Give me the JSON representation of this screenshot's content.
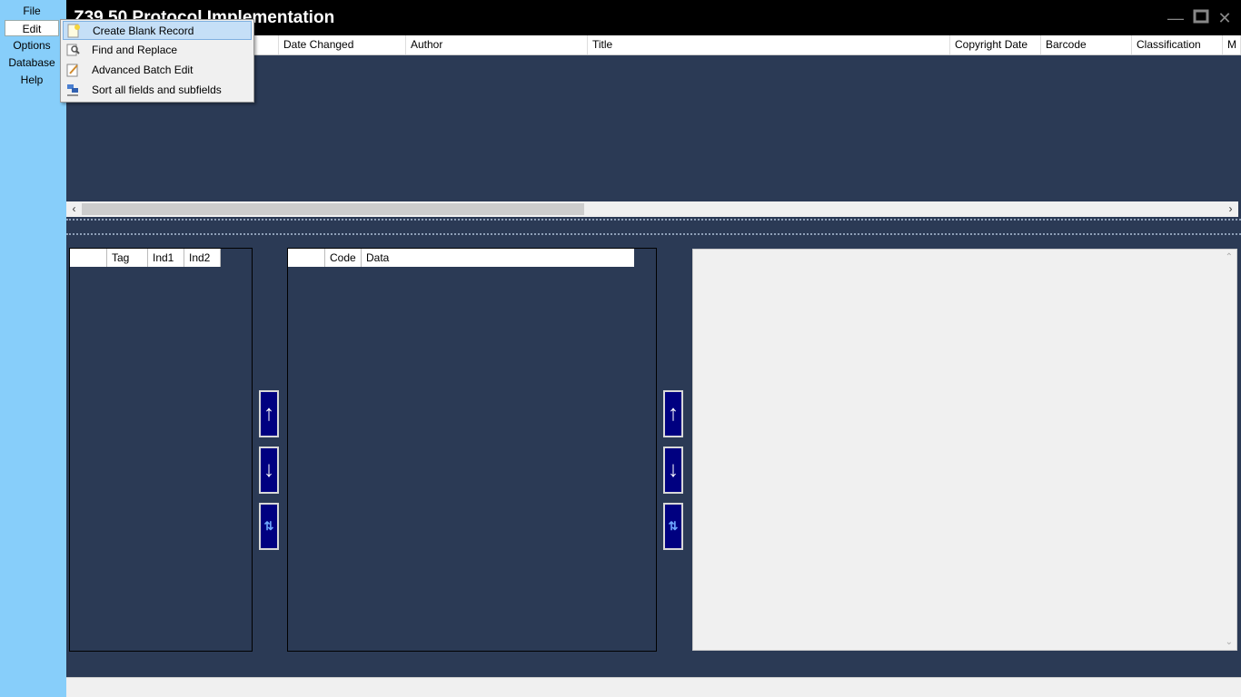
{
  "menu": {
    "items": [
      {
        "label": "File"
      },
      {
        "label": "Edit"
      },
      {
        "label": "Options"
      },
      {
        "label": "Database"
      },
      {
        "label": "Help"
      }
    ]
  },
  "titlebar": {
    "title": "Z39.50 Protocol Implementation"
  },
  "edit_menu": {
    "items": [
      {
        "label": "Create Blank Record",
        "icon": "blank-record-icon"
      },
      {
        "label": "Find and Replace",
        "icon": "find-replace-icon"
      },
      {
        "label": "Advanced Batch Edit",
        "icon": "batch-edit-icon"
      },
      {
        "label": "Sort all fields and subfields",
        "icon": "sort-az-icon"
      }
    ]
  },
  "records_grid": {
    "columns": [
      "Date Changed",
      "Author",
      "Title",
      "Copyright Date",
      "Barcode",
      "Classification",
      "M"
    ]
  },
  "fields_panel": {
    "columns": [
      "",
      "Tag",
      "Ind1",
      "Ind2"
    ]
  },
  "subfields_panel": {
    "columns": [
      "",
      "Code",
      "Data"
    ]
  },
  "colors": {
    "menu_bg": "#87cefa",
    "workspace_bg": "#2b3a55",
    "nav_button": "#000080",
    "title_bg": "#000000"
  }
}
